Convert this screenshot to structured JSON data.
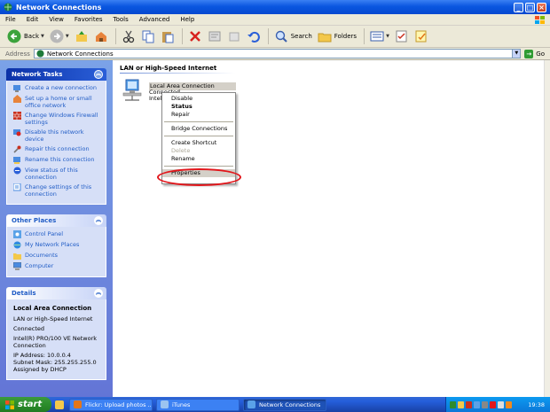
{
  "window": {
    "title": "Network Connections"
  },
  "menu": [
    "File",
    "Edit",
    "View",
    "Favorites",
    "Tools",
    "Advanced",
    "Help"
  ],
  "toolbar": {
    "back": "Back",
    "search": "Search",
    "folders": "Folders"
  },
  "address": {
    "label": "Address",
    "value": "Network Connections",
    "go": "Go"
  },
  "network_tasks": {
    "title": "Network Tasks",
    "items": [
      "Create a new connection",
      "Set up a home or small office network",
      "Change Windows Firewall settings",
      "Disable this network device",
      "Repair this connection",
      "Rename this connection",
      "View status of this connection",
      "Change settings of this connection"
    ]
  },
  "other_places": {
    "title": "Other Places",
    "items": [
      "Control Panel",
      "My Network Places",
      "Documents",
      "Computer"
    ]
  },
  "details": {
    "title": "Details",
    "name": "Local Area Connection",
    "lines": [
      "LAN or High-Speed Internet",
      "Connected",
      "Intel(R) PRO/100 VE Network Connection",
      "IP Address: 10.0.0.4",
      "Subnet Mask: 255.255.255.0",
      "Assigned by DHCP"
    ]
  },
  "content": {
    "group_title": "LAN or High-Speed Internet",
    "connection": {
      "name": "Local Area Connection",
      "status": "Connected",
      "device": "Intel"
    }
  },
  "context_menu": {
    "items": [
      "Disable",
      "Status",
      "Repair",
      "Bridge Connections",
      "Create Shortcut",
      "Delete",
      "Rename",
      "Properties"
    ]
  },
  "taskbar": {
    "start": "start",
    "buttons": [
      "Flickr: Upload photos ...",
      "iTunes",
      "Network Connections"
    ],
    "clock": "19:38"
  },
  "colors": {
    "title_bar": "#0a57e0",
    "task_pane": "#7ba2e7",
    "highlight_circle": "#e2161b",
    "start_button": "#2b8d2b"
  }
}
